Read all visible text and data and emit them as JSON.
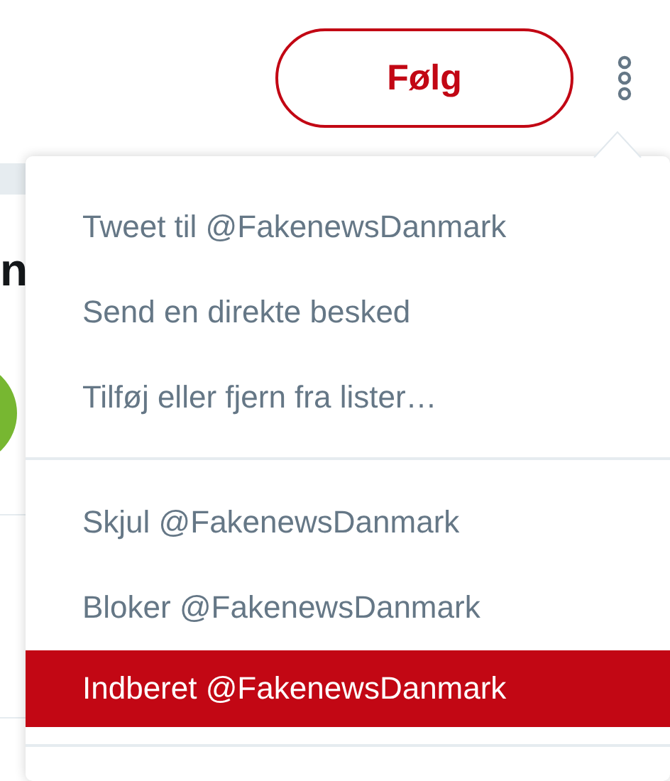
{
  "follow_button": {
    "label": "Følg"
  },
  "background": {
    "heading_fragment": "n"
  },
  "menu": {
    "groups": [
      [
        {
          "label": "Tweet til @FakenewsDanmark",
          "selected": false
        },
        {
          "label": "Send en direkte besked",
          "selected": false
        },
        {
          "label": "Tilføj eller fjern fra lister…",
          "selected": false
        }
      ],
      [
        {
          "label": "Skjul @FakenewsDanmark",
          "selected": false
        },
        {
          "label": "Bloker @FakenewsDanmark",
          "selected": false
        },
        {
          "label": "Indberet @FakenewsDanmark",
          "selected": true
        }
      ]
    ]
  }
}
